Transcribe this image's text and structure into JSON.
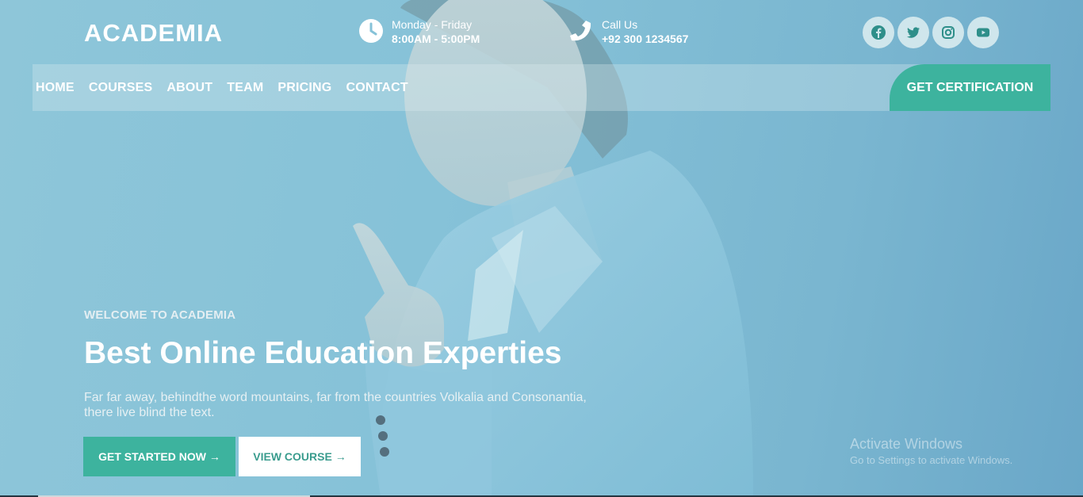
{
  "brand": {
    "logo": "ACADEMIA"
  },
  "header": {
    "hours": {
      "icon": "clock-icon",
      "line1": "Monday - Friday",
      "line2": "8:00AM - 5:00PM"
    },
    "phone": {
      "icon": "phone-icon",
      "line1": "Call Us",
      "line2": "+92 300 1234567"
    },
    "socials": [
      "facebook-icon",
      "twitter-icon",
      "instagram-icon",
      "youtube-icon"
    ]
  },
  "nav": {
    "links": [
      "HOME",
      "COURSES",
      "ABOUT",
      "TEAM",
      "PRICING",
      "CONTACT"
    ],
    "cta": "GET CERTIFICATION"
  },
  "hero": {
    "eyebrow": "WELCOME TO ACADEMIA",
    "title": "Best Online Education Experties",
    "description": "Far far away, behindthe word mountains, far from the countries Volkalia and Consonantia, there live blind the text.",
    "primary_button": "GET STARTED NOW →",
    "secondary_button": "VIEW COURSE →"
  },
  "watermark": {
    "line1": "Activate Windows",
    "line2": "Go to Settings to activate Windows."
  },
  "colors": {
    "accent": "#3db39e",
    "hero_overlay": "#86c2d8",
    "secondary_text": "#3a9c8e"
  }
}
